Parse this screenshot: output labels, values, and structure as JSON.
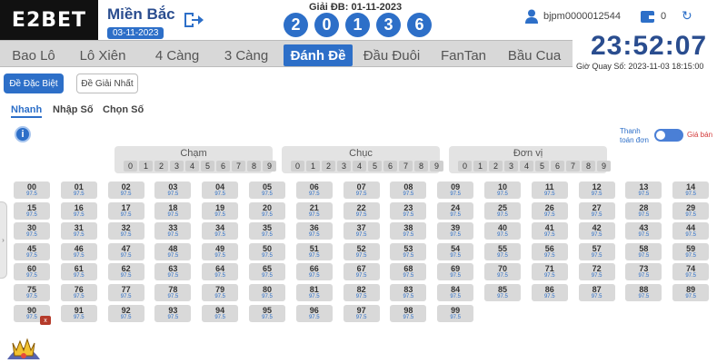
{
  "header": {
    "logo": "E2BET",
    "region": "Miền Bắc",
    "region_date": "03-11-2023",
    "draw_label": "Giải ĐB: 01-11-2023",
    "draw_digits": [
      "2",
      "0",
      "1",
      "3",
      "6"
    ],
    "username": "bjpm0000012544",
    "balance": "0"
  },
  "nav": {
    "tabs": [
      "Bao Lô",
      "Lô Xiên",
      "4 Càng",
      "3 Càng",
      "Đánh Đề",
      "Đầu Đuôi",
      "FanTan",
      "Bầu Cua"
    ],
    "active_tab": "Đánh Đề"
  },
  "clock": {
    "time": "23:52:07",
    "draw_time": "Giờ Quay Số: 2023-11-03 18:15:00"
  },
  "sub": {
    "de_dac_biet": "Đề Đặc Biệt",
    "de_giai_nhat": "Đề Giải Nhất",
    "modes": [
      "Nhanh",
      "Nhập Số",
      "Chọn Số"
    ],
    "active_mode": "Nhanh",
    "info_icon": "i",
    "pay_label": "Thanh toán đơn",
    "sell_label": "Giá bán"
  },
  "panels": [
    {
      "title": "Chạm",
      "digits": [
        "0",
        "1",
        "2",
        "3",
        "4",
        "5",
        "6",
        "7",
        "8",
        "9"
      ]
    },
    {
      "title": "Chục",
      "digits": [
        "0",
        "1",
        "2",
        "3",
        "4",
        "5",
        "6",
        "7",
        "8",
        "9"
      ]
    },
    {
      "title": "Đơn vị",
      "digits": [
        "0",
        "1",
        "2",
        "3",
        "4",
        "5",
        "6",
        "7",
        "8",
        "9"
      ]
    }
  ],
  "grid": {
    "odds": "97.5",
    "numbers": [
      "00",
      "01",
      "02",
      "03",
      "04",
      "05",
      "06",
      "07",
      "08",
      "09",
      "10",
      "11",
      "12",
      "13",
      "14",
      "15",
      "16",
      "17",
      "18",
      "19",
      "20",
      "21",
      "22",
      "23",
      "24",
      "25",
      "26",
      "27",
      "28",
      "29",
      "30",
      "31",
      "32",
      "33",
      "34",
      "35",
      "36",
      "37",
      "38",
      "39",
      "40",
      "41",
      "42",
      "43",
      "44",
      "45",
      "46",
      "47",
      "48",
      "49",
      "50",
      "51",
      "52",
      "53",
      "54",
      "55",
      "56",
      "57",
      "58",
      "59",
      "60",
      "61",
      "62",
      "63",
      "64",
      "65",
      "66",
      "67",
      "68",
      "69",
      "70",
      "71",
      "72",
      "73",
      "74",
      "75",
      "76",
      "77",
      "78",
      "79",
      "80",
      "81",
      "82",
      "83",
      "84",
      "85",
      "86",
      "87",
      "88",
      "89",
      "90",
      "91",
      "92",
      "93",
      "94",
      "95",
      "96",
      "97",
      "98",
      "99"
    ]
  },
  "remove_badge": "x",
  "icons": [
    "exit-icon",
    "user-icon",
    "wallet-icon",
    "refresh-icon",
    "info-icon",
    "chevron-icon",
    "emblem-icon"
  ],
  "colors": {
    "accent": "#2d6fc8",
    "clock": "#2a4d8f",
    "danger": "#d43a3a"
  }
}
